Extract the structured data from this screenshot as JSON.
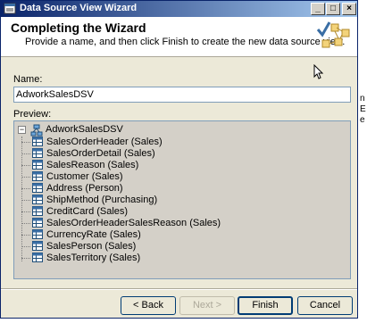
{
  "window": {
    "title": "Data Source View Wizard",
    "controls": {
      "minimize": "_",
      "maximize": "□",
      "close": "×"
    }
  },
  "header": {
    "title": "Completing the Wizard",
    "subtitle": "Provide a name, and then click Finish to create the new data source view.",
    "graphic_icon": "wizard-complete-graphic"
  },
  "name_field": {
    "label": "Name:",
    "value": "AdworkSalesDSV"
  },
  "preview": {
    "label": "Preview:",
    "root": {
      "label": "AdworkSalesDSV",
      "expander": "−"
    },
    "items": [
      "SalesOrderHeader (Sales)",
      "SalesOrderDetail (Sales)",
      "SalesReason (Sales)",
      "Customer (Sales)",
      "Address (Person)",
      "ShipMethod (Purchasing)",
      "CreditCard (Sales)",
      "SalesOrderHeaderSalesReason (Sales)",
      "CurrencyRate (Sales)",
      "SalesPerson (Sales)",
      "SalesTerritory (Sales)"
    ]
  },
  "buttons": {
    "back": "< Back",
    "next": "Next >",
    "finish": "Finish",
    "cancel": "Cancel"
  },
  "side_letters": [
    "n",
    "E",
    "e"
  ],
  "colors": {
    "title_start": "#0a246a",
    "title_end": "#a6caf0",
    "dialog_bg": "#ece9d8",
    "preview_bg": "#d4d0c8"
  }
}
